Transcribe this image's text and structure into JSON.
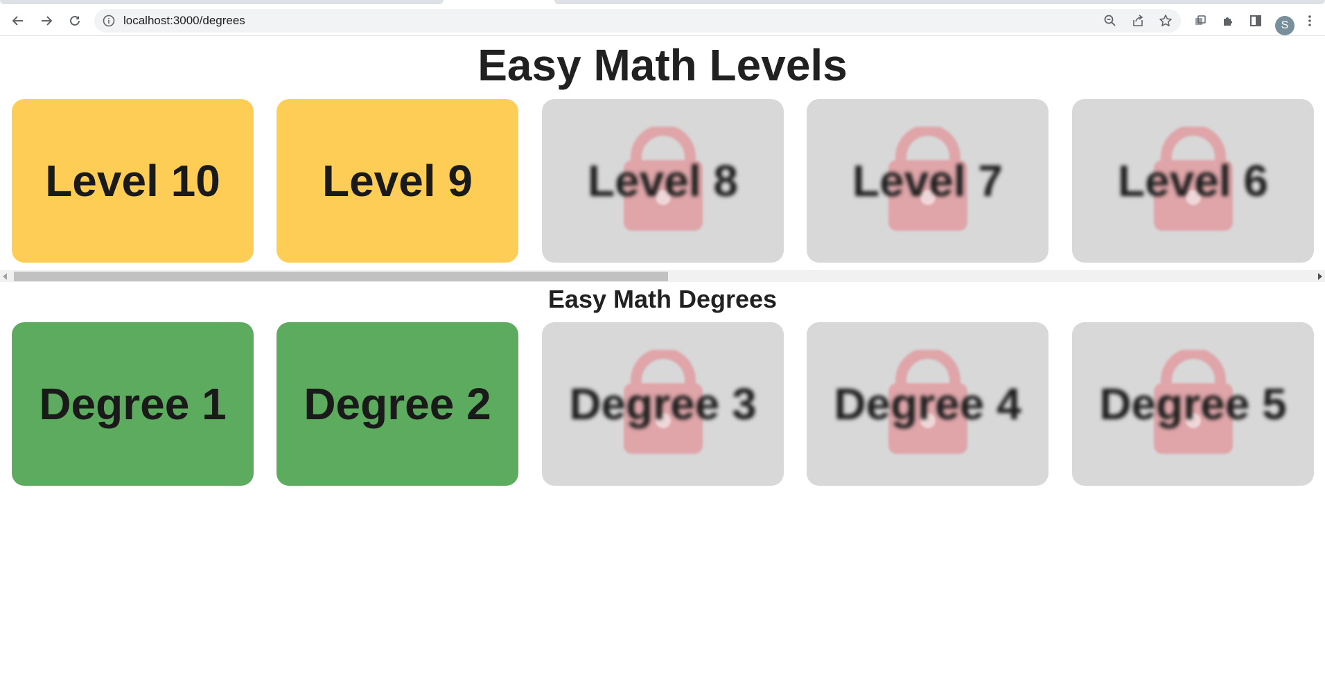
{
  "browser": {
    "url": "localhost:3000/degrees"
  },
  "page": {
    "title": "Easy Math Levels",
    "degrees_title": "Easy Math Degrees"
  },
  "user": {
    "avatar_initial": "S"
  },
  "levels": [
    {
      "label": "Level 10",
      "locked": false,
      "color": "#fdcd55"
    },
    {
      "label": "Level 9",
      "locked": false,
      "color": "#fdcd55"
    },
    {
      "label": "Level 8",
      "locked": true,
      "color": "#d8d8d8"
    },
    {
      "label": "Level 7",
      "locked": true,
      "color": "#d8d8d8"
    },
    {
      "label": "Level 6",
      "locked": true,
      "color": "#d8d8d8"
    }
  ],
  "degrees": [
    {
      "label": "Degree 1",
      "locked": false,
      "color": "#5dab5f"
    },
    {
      "label": "Degree 2",
      "locked": false,
      "color": "#5dab5f"
    },
    {
      "label": "Degree 3",
      "locked": true,
      "color": "#d8d8d8"
    },
    {
      "label": "Degree 4",
      "locked": true,
      "color": "#d8d8d8"
    },
    {
      "label": "Degree 5",
      "locked": true,
      "color": "#d8d8d8"
    }
  ],
  "icons": {
    "lock": "lock-icon",
    "back": "back-arrow-icon",
    "forward": "forward-arrow-icon",
    "reload": "reload-icon"
  }
}
